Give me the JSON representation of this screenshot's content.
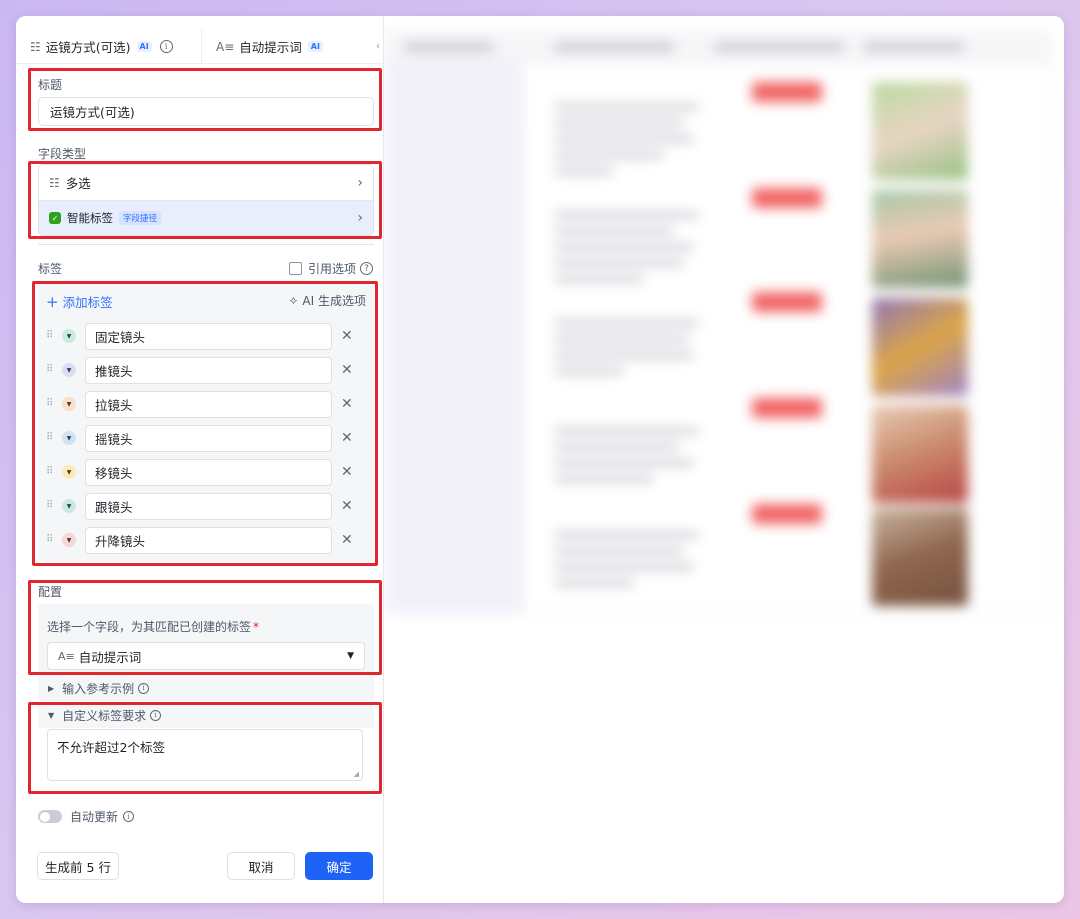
{
  "header": {
    "field_tab": {
      "icon": "multi-select-icon",
      "label": "运镜方式(可选)",
      "badge": "AI"
    },
    "prompt_tab": {
      "icon": "text-field-icon",
      "label": "自动提示词",
      "badge": "AI"
    }
  },
  "title_section": {
    "label": "标题",
    "value": "运镜方式(可选)"
  },
  "field_type": {
    "label": "字段类型",
    "type_value": "多选",
    "smart_tag_label": "智能标签",
    "smart_tag_badge": "字段捷径"
  },
  "tags_section": {
    "label": "标签",
    "reference_label": "引用选项",
    "add_label": "添加标签",
    "ai_generate_label": "AI 生成选项",
    "tags": [
      {
        "label": "固定镜头",
        "color": "#c7eddf"
      },
      {
        "label": "推镜头",
        "color": "#dcdcf7"
      },
      {
        "label": "拉镜头",
        "color": "#fbe0c8"
      },
      {
        "label": "摇镜头",
        "color": "#cfe4f7"
      },
      {
        "label": "移镜头",
        "color": "#fdebb5"
      },
      {
        "label": "跟镜头",
        "color": "#c7ebe2"
      },
      {
        "label": "升降镜头",
        "color": "#f9d4d8"
      }
    ]
  },
  "config_section": {
    "label": "配置",
    "select_prompt": "选择一个字段，为其匹配已创建的标签",
    "required_mark": "*",
    "selected_field": "自动提示词",
    "selected_field_icon": "text-field-icon"
  },
  "reference_examples": {
    "label": "输入参考示例"
  },
  "custom_requirements": {
    "label": "自定义标签要求",
    "value": "不允许超过2个标签"
  },
  "auto_update": {
    "label": "自动更新"
  },
  "footer": {
    "generate_label": "生成前 5 行",
    "cancel_label": "取消",
    "confirm_label": "确定"
  },
  "colors": {
    "primary": "#1e63f5",
    "highlight_border": "#e0262f",
    "link": "#3370ff"
  }
}
